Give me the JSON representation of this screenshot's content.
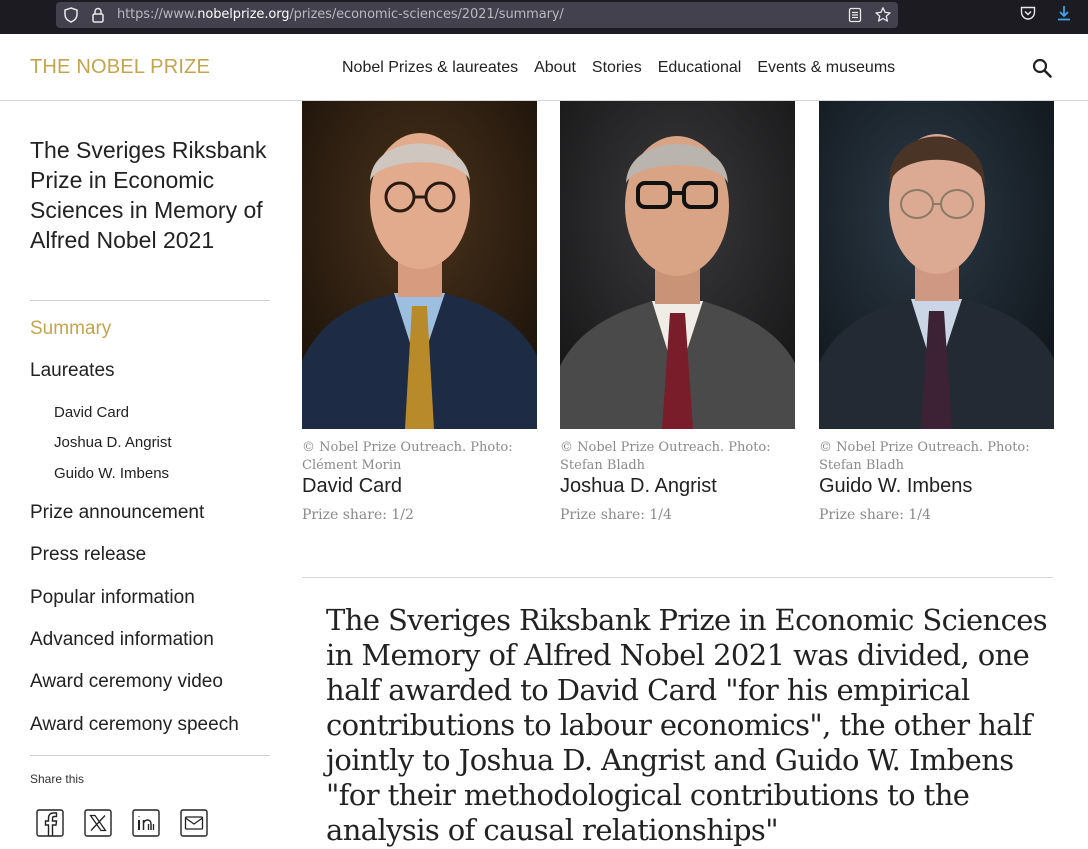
{
  "browser": {
    "url_prefix": "https://www.",
    "url_domain": "nobelprize.org",
    "url_path": "/prizes/economic-sciences/2021/summary/"
  },
  "header": {
    "logo": "THE NOBEL PRIZE",
    "nav": [
      "Nobel Prizes & laureates",
      "About",
      "Stories",
      "Educational",
      "Events & museums"
    ]
  },
  "sidebar": {
    "title": "The Sveriges Riksbank Prize in Economic Sciences in Memory of Alfred Nobel 2021",
    "summary": "Summary",
    "laureates": "Laureates",
    "laureate_links": [
      "David Card",
      "Joshua D. Angrist",
      "Guido W. Imbens"
    ],
    "links": [
      "Prize announcement",
      "Press release",
      "Popular information",
      "Advanced information",
      "Award ceremony video",
      "Award ceremony speech"
    ],
    "share_label": "Share this"
  },
  "laureates": [
    {
      "credit": "© Nobel Prize Outreach. Photo: Clément Morin",
      "name": "David Card",
      "share": "Prize share: 1/2"
    },
    {
      "credit": "© Nobel Prize Outreach. Photo: Stefan Bladh",
      "name": "Joshua D. Angrist",
      "share": "Prize share: 1/4"
    },
    {
      "credit": "© Nobel Prize Outreach. Photo: Stefan Bladh",
      "name": "Guido W. Imbens",
      "share": "Prize share: 1/4"
    }
  ],
  "citation": "The Sveriges Riksbank Prize in Economic Sciences in Memory of Alfred Nobel 2021 was divided, one half awarded to David Card \"for his empirical contributions to labour economics\", the other half jointly to Joshua D. Angrist and Guido W. Imbens \"for their methodological contributions to the analysis of causal relationships\"",
  "colors": {
    "accent": "#c5a44e",
    "chrome": "#1c1b22",
    "url_bg": "#42414d"
  },
  "icons": [
    "shield-icon",
    "lock-icon",
    "reader-icon",
    "star-icon",
    "pocket-icon",
    "download-icon",
    "search-icon",
    "facebook-icon",
    "x-icon",
    "linkedin-icon",
    "email-icon"
  ]
}
